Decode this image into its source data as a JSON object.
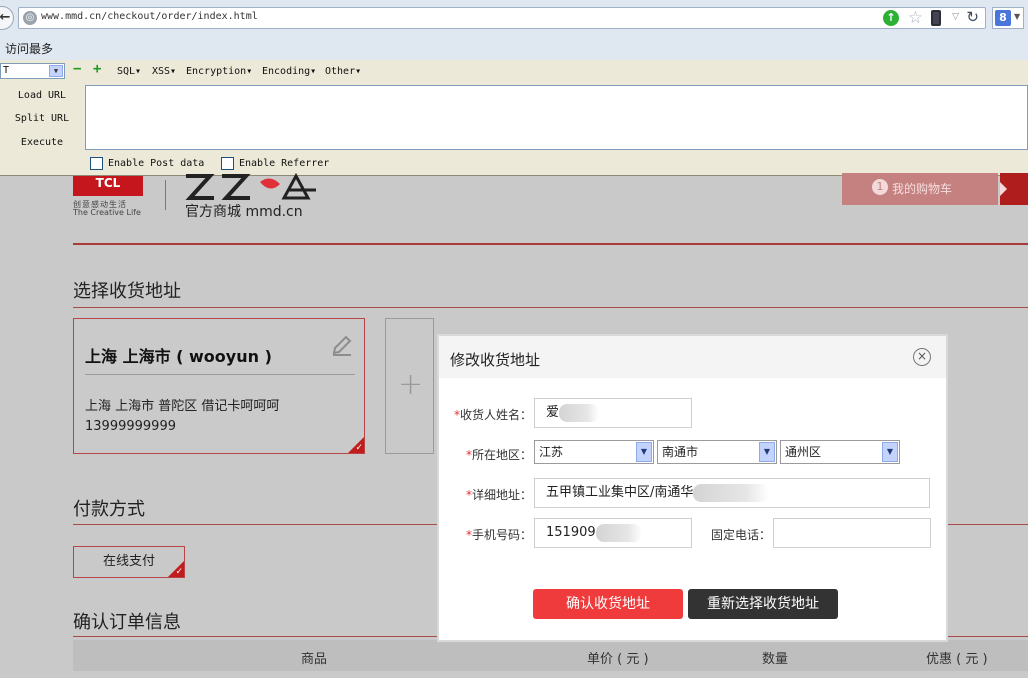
{
  "browser": {
    "url": "www.mmd.cn/checkout/order/index.html",
    "bookmark": "访问最多",
    "search_engine_icon": "google-icon"
  },
  "hackbar": {
    "select_value": "T",
    "menus": [
      "SQL▾",
      "XSS▾",
      "Encryption▾",
      "Encoding▾",
      "Other▾"
    ],
    "load_url": "Load URL",
    "split_url": "Split URL",
    "execute": "Execute",
    "textarea_value": "",
    "enable_post": "Enable Post data",
    "enable_referrer": "Enable Referrer"
  },
  "site": {
    "brand": "TCL",
    "brand_slogan_cn": "创意感动生活",
    "brand_slogan_en": "The Creative Life",
    "site_name": "官方商城 mmd.cn",
    "cart_count": "1",
    "cart_label": "我的购物车"
  },
  "sections": {
    "address_title": "选择收货地址",
    "payment_title": "付款方式",
    "order_title": "确认订单信息"
  },
  "address_card": {
    "name": "上海 上海市 ( wooyun )",
    "detail": "上海 上海市 普陀区 借记卡呵呵呵",
    "phone": "13999999999"
  },
  "payment": {
    "option": "在线支付"
  },
  "order_table": {
    "headers": [
      "商品",
      "单价 ( 元 )",
      "数量",
      "优惠 ( 元 )"
    ]
  },
  "modal": {
    "title": "修改收货地址",
    "name_label": "收货人姓名：",
    "name_value": "爱",
    "region_label": "所在地区：",
    "province": "江苏",
    "city": "南通市",
    "district": "通州区",
    "address_label": "详细地址：",
    "address_value": "五甲镇工业集中区/南通华",
    "mobile_label": "手机号码：",
    "mobile_value": "151909",
    "phone_label": "固定电话：",
    "phone_value": "",
    "required_mark": "*",
    "confirm": "确认收货地址",
    "reselect": "重新选择收货地址"
  }
}
